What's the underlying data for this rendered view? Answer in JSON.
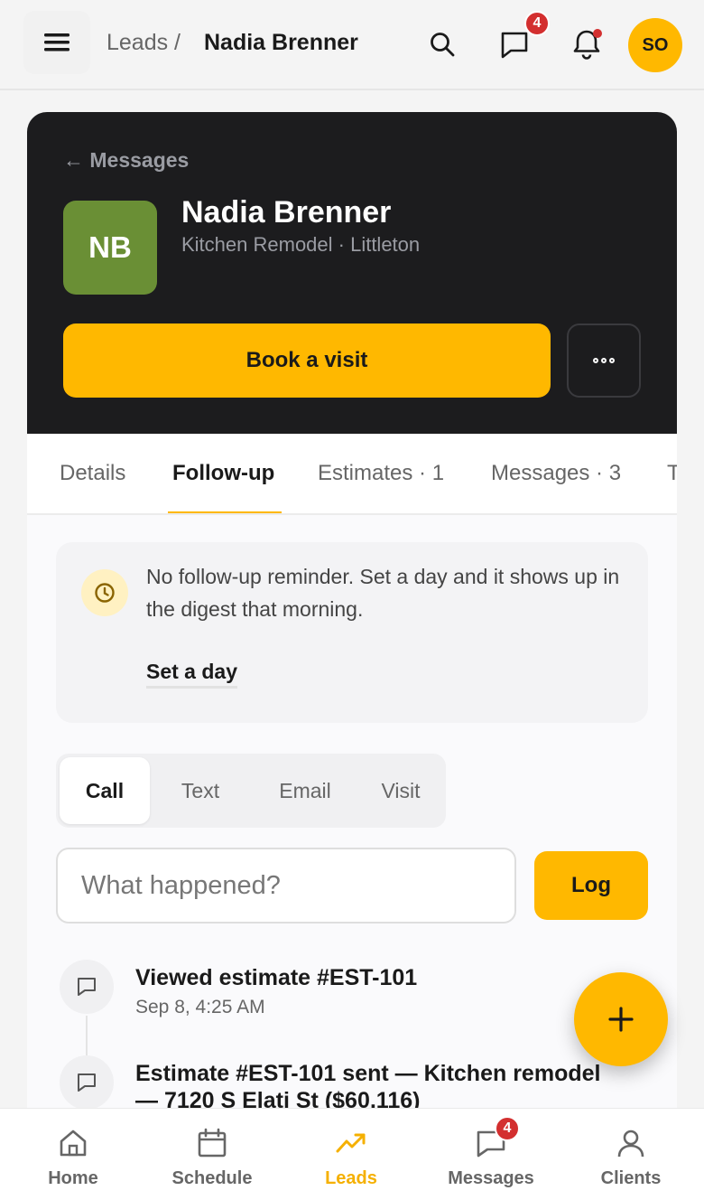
{
  "topbar": {
    "breadcrumb_parent": "Leads /",
    "breadcrumb_current": "Nadia Brenner",
    "messages_badge": "4",
    "user_initials": "SO"
  },
  "hero": {
    "back_label": "← Messages",
    "avatar_initials": "NB",
    "avatar_color": "#6a8f35",
    "name": "Nadia Brenner",
    "subtitle": "Kitchen Remodel · Littleton",
    "book_label": "Book a visit"
  },
  "tabs": [
    {
      "label": "Details"
    },
    {
      "label": "Follow-up"
    },
    {
      "label": "Estimates · 1"
    },
    {
      "label": "Messages · 3"
    },
    {
      "label": "T"
    }
  ],
  "reminder": {
    "text": "No follow-up reminder. Set a day and it shows up in the digest that morning.",
    "link_label": "Set a day"
  },
  "log_types": [
    {
      "label": "Call"
    },
    {
      "label": "Text"
    },
    {
      "label": "Email"
    },
    {
      "label": "Visit"
    }
  ],
  "log_form": {
    "placeholder": "What happened?",
    "button_label": "Log"
  },
  "timeline": [
    {
      "title": "Viewed estimate #EST-101",
      "time": "Sep 8, 4:25 AM"
    },
    {
      "title": "Estimate #EST-101 sent — Kitchen remodel",
      "title_line2": "— 7120 S Elati St ($60,116)"
    }
  ],
  "bottom_nav": [
    {
      "label": "Home",
      "icon": "home-icon"
    },
    {
      "label": "Schedule",
      "icon": "calendar-icon"
    },
    {
      "label": "Leads",
      "icon": "trending-up-icon"
    },
    {
      "label": "Messages",
      "icon": "chat-icon",
      "badge": "4"
    },
    {
      "label": "Clients",
      "icon": "person-icon"
    }
  ],
  "colors": {
    "accent": "#ffb800",
    "hero_bg": "#1c1c1e",
    "badge": "#d32f2f"
  }
}
